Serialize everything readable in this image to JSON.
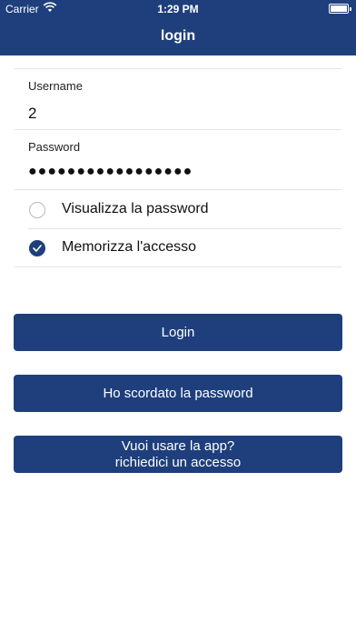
{
  "status": {
    "carrier": "Carrier",
    "time": "1:29 PM"
  },
  "nav": {
    "title": "login"
  },
  "form": {
    "username_label": "Username",
    "username_value": "2",
    "password_label": "Password",
    "password_value": "●●●●●●●●●●●●●●●●●",
    "show_password_label": "Visualizza la password",
    "show_password_checked": false,
    "remember_label": "Memorizza l'accesso",
    "remember_checked": true
  },
  "buttons": {
    "login": "Login",
    "forgot": "Ho scordato la password",
    "request_line1": "Vuoi usare la app?",
    "request_line2": "richiedici un accesso"
  },
  "colors": {
    "brand": "#1e3f7c"
  }
}
